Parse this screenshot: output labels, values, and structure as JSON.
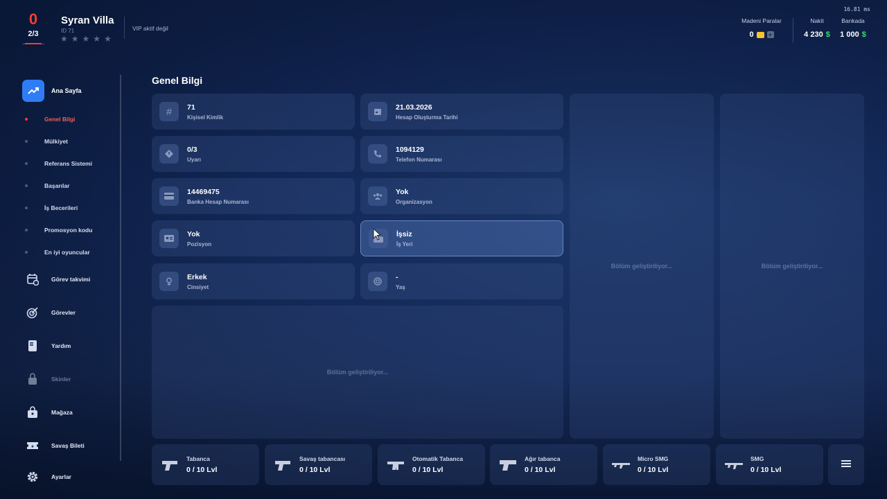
{
  "header": {
    "ping": "16.81 ms",
    "level": "0",
    "level_progress": "2/3",
    "player_name": "Syran Villa",
    "player_id": "ID 71",
    "stars_filled": 0,
    "stars_total": 5,
    "vip_status": "VIP aktif değil",
    "coins_label": "Madeni Paralar",
    "coins_value": "0",
    "cash_label": "Nakit",
    "cash_value": "4 230",
    "bank_label": "Bankada",
    "bank_value": "1 000",
    "currency_symbol": "$"
  },
  "sidebar": {
    "home_label": "Ana Sayfa",
    "sub_items": [
      {
        "label": "Genel Bilgi",
        "active": true
      },
      {
        "label": "Mülkiyet",
        "active": false
      },
      {
        "label": "Referans Sistemi",
        "active": false
      },
      {
        "label": "Başarılar",
        "active": false
      },
      {
        "label": "İş Becerileri",
        "active": false
      },
      {
        "label": "Promosyon kodu",
        "active": false
      },
      {
        "label": "En iyi oyuncular",
        "active": false
      }
    ],
    "nav_items": [
      {
        "label": "Görev takvimi",
        "icon": "calendar-icon"
      },
      {
        "label": "Görevler",
        "icon": "target-icon"
      },
      {
        "label": "Yardım",
        "icon": "book-icon"
      },
      {
        "label": "Skinler",
        "icon": "lock-icon",
        "disabled": true
      },
      {
        "label": "Mağaza",
        "icon": "shopping-bag-icon"
      },
      {
        "label": "Savaş Bileti",
        "icon": "ticket-icon"
      },
      {
        "label": "Ayarlar",
        "icon": "gear-icon"
      }
    ]
  },
  "main": {
    "title": "Genel Bilgi",
    "cards": [
      {
        "value": "71",
        "label": "Kişisel Kimlik",
        "icon": "hash-icon"
      },
      {
        "value": "21.03.2026",
        "label": "Hesap Oluşturma Tarihi",
        "icon": "calendar-icon"
      },
      {
        "value": "0/3",
        "label": "Uyarı",
        "icon": "warning-icon"
      },
      {
        "value": "1094129",
        "label": "Telefon Numarası",
        "icon": "phone-icon"
      },
      {
        "value": "14469475",
        "label": "Banka Hesap Numarası",
        "icon": "bank-card-icon"
      },
      {
        "value": "Yok",
        "label": "Organizasyon",
        "icon": "group-icon"
      },
      {
        "value": "Yok",
        "label": "Pozisyon",
        "icon": "id-card-icon"
      },
      {
        "value": "İşsiz",
        "label": "İş Yeri",
        "icon": "briefcase-icon"
      },
      {
        "value": "Erkek",
        "label": "Cinsiyet",
        "icon": "gender-icon"
      },
      {
        "value": "-",
        "label": "Yaş",
        "icon": "age-icon"
      }
    ],
    "placeholder_text": "Bölüm geliştiriliyor..."
  },
  "weapons": [
    {
      "name": "Tabanca",
      "level": "0 / 10 Lvl"
    },
    {
      "name": "Savaş tabancası",
      "level": "0 / 10 Lvl"
    },
    {
      "name": "Otomatik Tabanca",
      "level": "0 / 10 Lvl"
    },
    {
      "name": "Ağır tabanca",
      "level": "0 / 10 Lvl"
    },
    {
      "name": "Micro SMG",
      "level": "0 / 10 Lvl"
    },
    {
      "name": "SMG",
      "level": "0 / 10 Lvl"
    }
  ]
}
